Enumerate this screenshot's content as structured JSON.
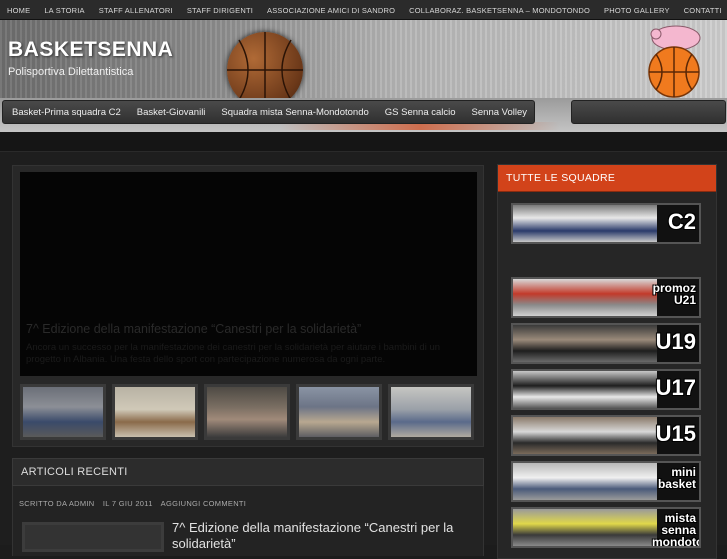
{
  "top_nav": [
    "HOME",
    "LA STORIA",
    "STAFF ALLENATORI",
    "STAFF DIRIGENTI",
    "ASSOCIAZIONE AMICI DI SANDRO",
    "COLLABORAZ. BASKETSENNA – MONDOTONDO",
    "PHOTO GALLERY",
    "CONTATTI"
  ],
  "site": {
    "title": "BASKETSENNA",
    "subtitle": "Polisportiva Dilettantistica"
  },
  "category_nav": [
    "Basket-Prima squadra C2",
    "Basket-Giovanili",
    "Squadra mista Senna-Mondotondo",
    "GS Senna calcio",
    "Senna Volley"
  ],
  "featured": {
    "title": "7^ Edizione della manifestazione “Canestri per la solidarietà”",
    "excerpt": "Ancora un successo per la manifestazione dei canestri per la solidarietà per aiutare i bambini di un progetto in Albania. Una festa dello sport con partecipazione numerosa da ogni parte.",
    "thumbnails": [
      "thumb-1",
      "thumb-2",
      "thumb-3",
      "thumb-4",
      "thumb-5"
    ]
  },
  "recent": {
    "heading": "ARTICOLI RECENTI",
    "meta_author": "SCRITTO DA ADMIN",
    "meta_date": "IL 7 GIU 2011",
    "meta_comments": "AGGIUNGI COMMENTI",
    "post_title": "7^ Edizione della manifestazione “Canestri per la solidarietà”"
  },
  "sidebar": {
    "heading": "TUTTE LE SQUADRE",
    "teams": [
      {
        "label": "C2",
        "size": "big"
      },
      {
        "label": "promoz U21",
        "size": "small"
      },
      {
        "label": "U19",
        "size": "big"
      },
      {
        "label": "U17",
        "size": "big"
      },
      {
        "label": "U15",
        "size": "big"
      },
      {
        "label": "mini basket",
        "size": "small"
      },
      {
        "label": "mista senna mondotondo",
        "size": "small"
      }
    ]
  },
  "colors": {
    "accent": "#d2431a",
    "background": "#1c1c1c"
  }
}
